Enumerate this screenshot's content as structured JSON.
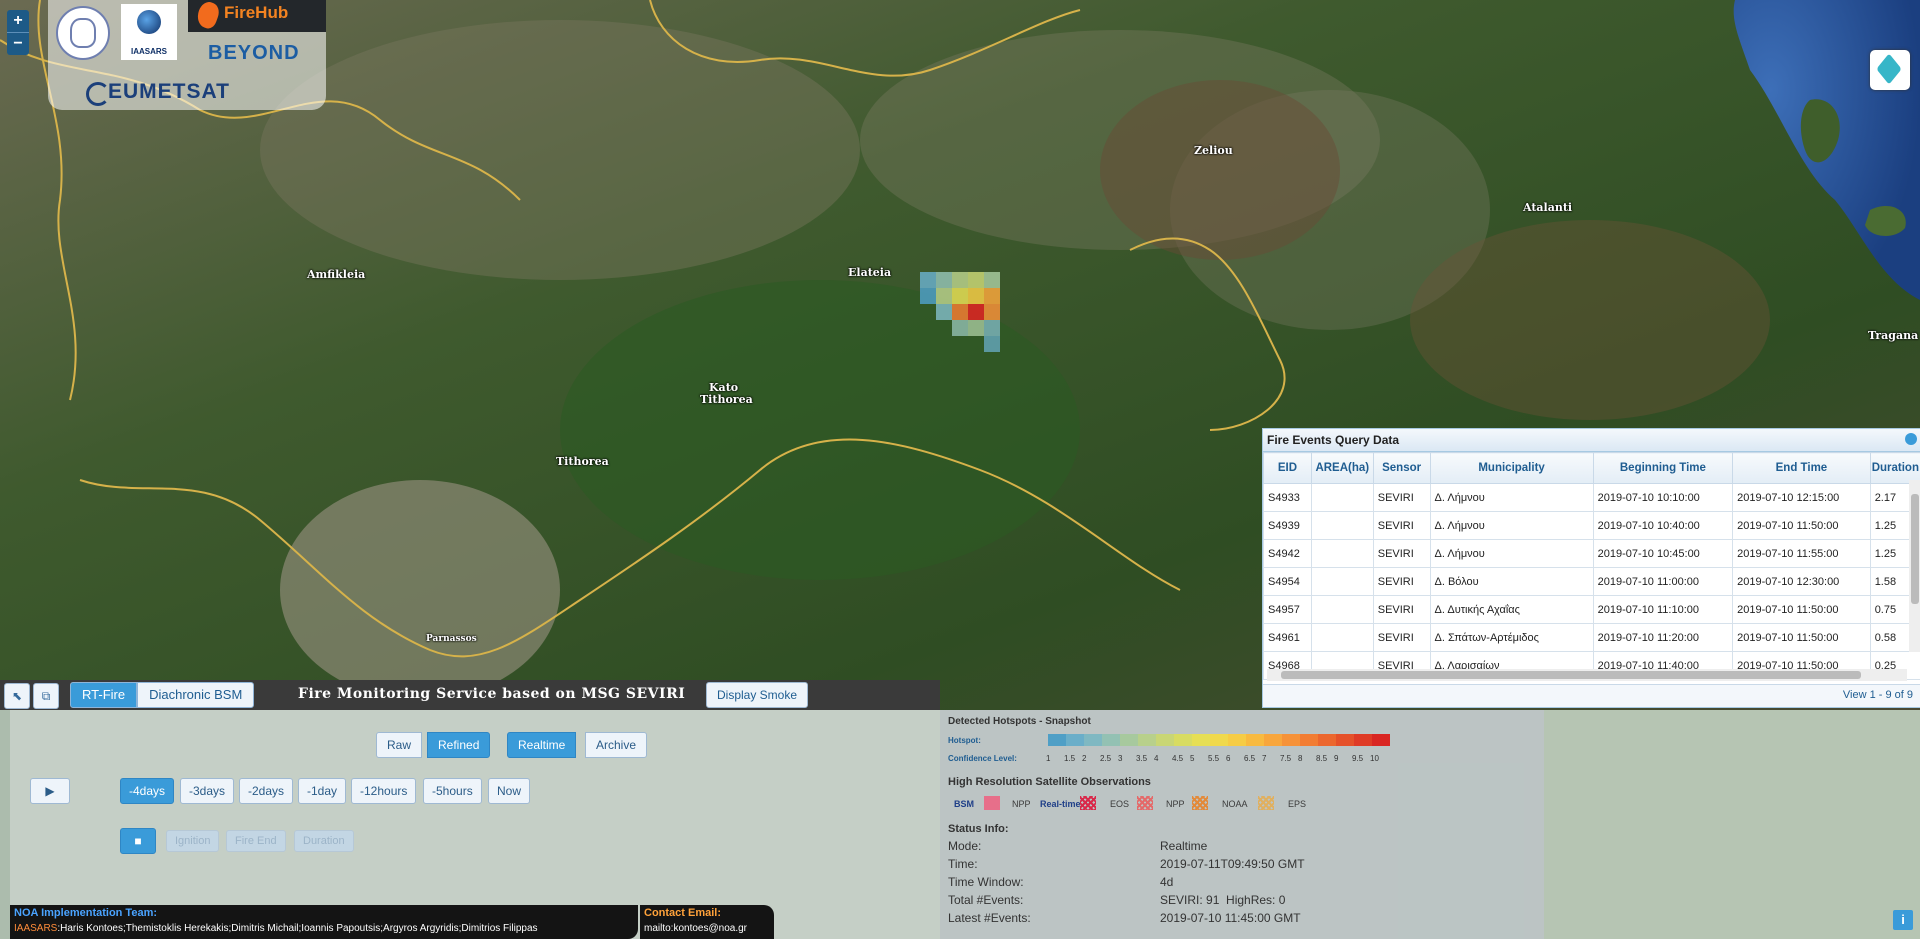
{
  "map": {
    "zoom_in": "+",
    "zoom_out": "−",
    "places": [
      "Amfikleia",
      "Elateia",
      "Kato",
      "Tithorea",
      "Tithorea",
      "Zeliou",
      "Atalanti",
      "Tragana",
      "Parnassos"
    ]
  },
  "logos": {
    "iaasars": "IAASARS",
    "firehub": "FireHub",
    "beyond": "BEYOND",
    "eumetsat": "EUMETSAT"
  },
  "bar": {
    "tab_rt_fire": "RT-Fire",
    "tab_diachronic": "Diachronic BSM",
    "title": "Fire Monitoring Service based on MSG SEVIRI",
    "display_smoke": "Display Smoke"
  },
  "grid": {
    "caption": "Fire Events Query Data",
    "columns": [
      "EID",
      "AREA(ha)",
      "Sensor",
      "Municipality",
      "Beginning Time",
      "End Time",
      "Duration"
    ],
    "rows": [
      [
        "S4933",
        "",
        "SEVIRI",
        "Δ. Λήμνου",
        "2019-07-10 10:10:00",
        "2019-07-10 12:15:00",
        "2.17"
      ],
      [
        "S4939",
        "",
        "SEVIRI",
        "Δ. Λήμνου",
        "2019-07-10 10:40:00",
        "2019-07-10 11:50:00",
        "1.25"
      ],
      [
        "S4942",
        "",
        "SEVIRI",
        "Δ. Λήμνου",
        "2019-07-10 10:45:00",
        "2019-07-10 11:55:00",
        "1.25"
      ],
      [
        "S4954",
        "",
        "SEVIRI",
        "Δ. Βόλου",
        "2019-07-10 11:00:00",
        "2019-07-10 12:30:00",
        "1.58"
      ],
      [
        "S4957",
        "",
        "SEVIRI",
        "Δ. Δυτικής Αχαΐας",
        "2019-07-10 11:10:00",
        "2019-07-10 11:50:00",
        "0.75"
      ],
      [
        "S4961",
        "",
        "SEVIRI",
        "Δ. Σπάτων-Αρτέμιδος",
        "2019-07-10 11:20:00",
        "2019-07-10 11:50:00",
        "0.58"
      ],
      [
        "S4968",
        "",
        "SEVIRI",
        "Δ. Λαρισαίων",
        "2019-07-10 11:40:00",
        "2019-07-10 11:50:00",
        "0.25"
      ]
    ],
    "pager": "View 1 - 9 of 9"
  },
  "controls": {
    "raw": "Raw",
    "refined": "Refined",
    "realtime": "Realtime",
    "archive": "Archive",
    "play": "▶",
    "stop": "■",
    "windows": [
      "-4days",
      "-3days",
      "-2days",
      "-1day",
      "-12hours",
      "-5hours",
      "Now"
    ],
    "ignition": "Ignition",
    "fire_end": "Fire End",
    "duration": "Duration"
  },
  "credits": {
    "team_label": "NOA Implementation Team:",
    "org": "IAASARS",
    "team": ":Haris Kontoes;Themistoklis Herekakis;Dimitris Michail;Ioannis Papoutsis;Argyros Argyridis;Dimitrios Filippas",
    "contact_label": "Contact Email:",
    "contact": "mailto:kontoes@noa.gr"
  },
  "legend": {
    "snapshot_title": "Detected Hotspots - Snapshot",
    "hotspot_label": "Hotspot:",
    "confidence_label": "Confidence Level:",
    "levels": [
      "1",
      "1.5",
      "2",
      "2.5",
      "3",
      "3.5",
      "4",
      "4.5",
      "5",
      "5.5",
      "6",
      "6.5",
      "7",
      "7.5",
      "8",
      "8.5",
      "9",
      "9.5",
      "10"
    ],
    "colors": [
      "#4f9fc6",
      "#6aaec9",
      "#7fb8c2",
      "#93c1b3",
      "#a7c99e",
      "#b8d08b",
      "#c9d675",
      "#d8dc62",
      "#e6df55",
      "#f0d94c",
      "#f6cc45",
      "#f8ba40",
      "#f8a63c",
      "#f69238",
      "#f27d33",
      "#ec672e",
      "#e5512a",
      "#df3b26",
      "#d92622"
    ],
    "hires_title": "High Resolution Satellite Observations",
    "bsm": "BSM",
    "npp": "NPP",
    "realtime": "Real-time",
    "eos": "EOS",
    "npp2": "NPP",
    "noaa": "NOAA",
    "eps": "EPS"
  },
  "status": {
    "title": "Status Info:",
    "mode_label": "Mode:",
    "mode": "Realtime",
    "time_label": "Time:",
    "time": "2019-07-11T09:49:50 GMT",
    "window_label": "Time Window:",
    "window": "4d",
    "total_label": "Total #Events:",
    "total": "SEVIRI: 91  HighRes: 0",
    "latest_label": "Latest #Events:",
    "latest": "2019-07-10 11:45:00 GMT"
  },
  "info": "i"
}
